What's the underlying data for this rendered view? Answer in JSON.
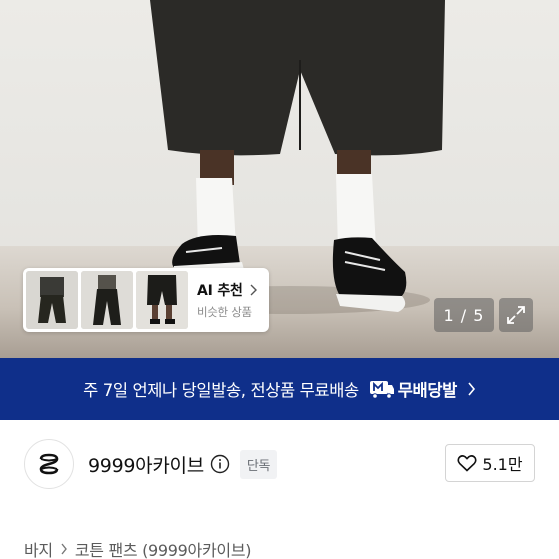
{
  "gallery": {
    "ai_card": {
      "title": "AI 추천",
      "subtitle": "비슷한 상품",
      "thumbnails": [
        "thumb-1",
        "thumb-2",
        "thumb-3"
      ]
    },
    "counter": "1 / 5",
    "expand_icon": "expand-icon"
  },
  "banner": {
    "text": "주 7일 언제나 당일발송, 전상품 무료배송",
    "badge_icon": "m-delivery-icon",
    "strong_text": "무배당발",
    "color": "#0f2f8a"
  },
  "shop": {
    "name": "9999아카이브",
    "badge": "단독",
    "likes": "5.1만"
  },
  "breadcrumb": {
    "category": "바지",
    "product": "코튼 팬츠 (9999아카이브)"
  }
}
